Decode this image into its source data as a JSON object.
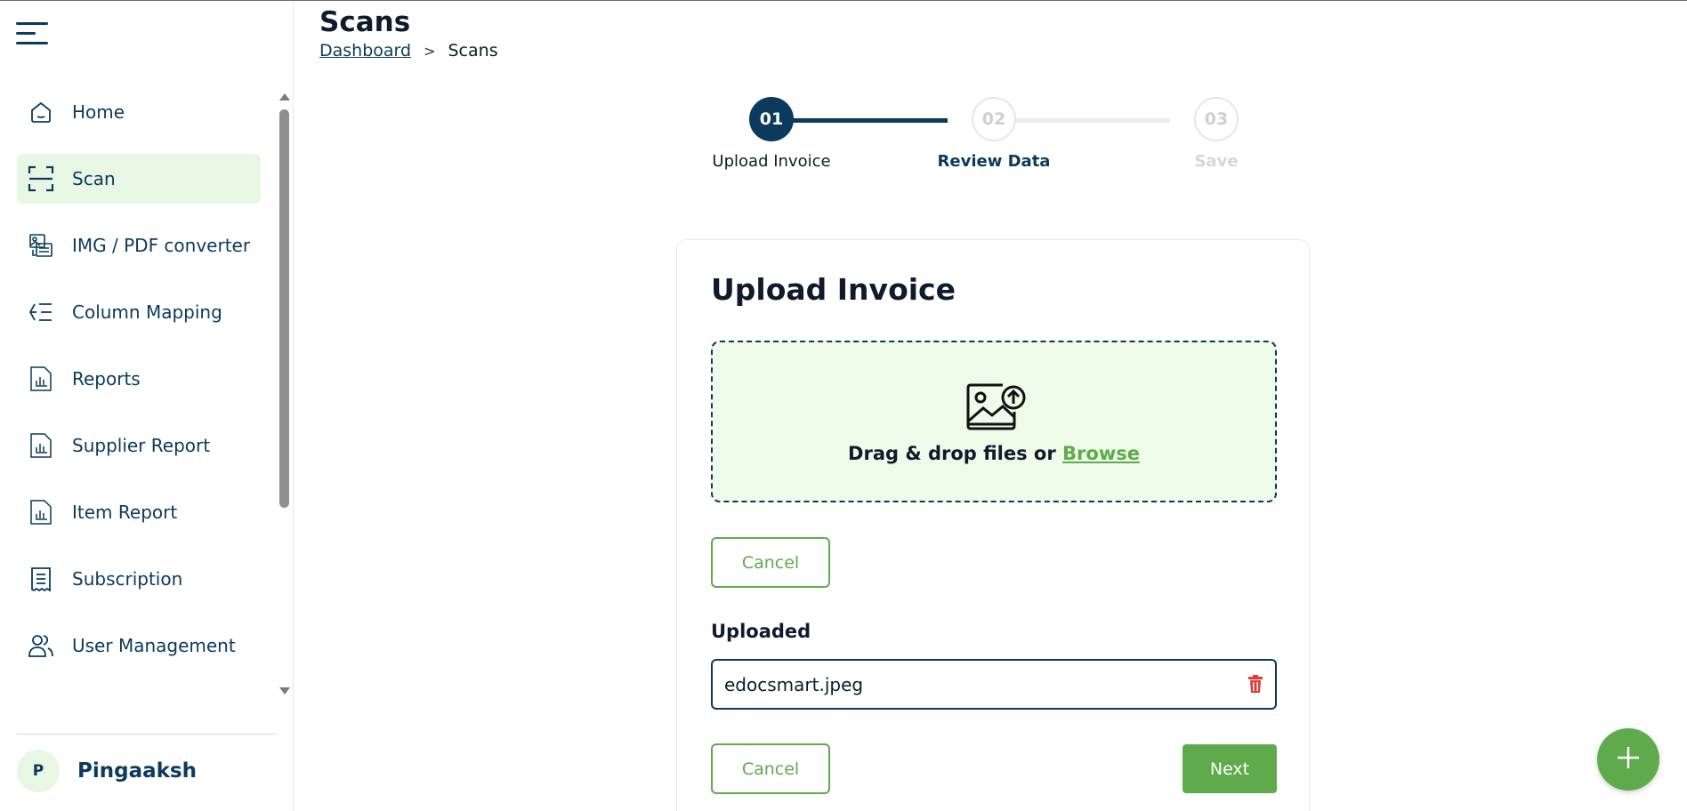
{
  "sidebar": {
    "menu_icon": "hamburger-icon",
    "items": [
      {
        "label": "Home",
        "icon": "home-icon"
      },
      {
        "label": "Scan",
        "icon": "scan-icon",
        "active": true
      },
      {
        "label": "IMG / PDF converter",
        "icon": "image-pdf-icon"
      },
      {
        "label": "Column Mapping",
        "icon": "column-mapping-icon"
      },
      {
        "label": "Reports",
        "icon": "report-chart-icon"
      },
      {
        "label": "Supplier Report",
        "icon": "report-chart-icon"
      },
      {
        "label": "Item Report",
        "icon": "report-chart-icon"
      },
      {
        "label": "Subscription",
        "icon": "receipt-icon"
      },
      {
        "label": "User Management",
        "icon": "users-icon"
      }
    ],
    "user": {
      "initial": "P",
      "name": "Pingaaksh"
    }
  },
  "header": {
    "title": "Scans",
    "breadcrumb": {
      "link": "Dashboard",
      "separator": ">",
      "current": "Scans"
    }
  },
  "stepper": {
    "steps": [
      {
        "number": "01",
        "label": "Upload Invoice",
        "state": "active"
      },
      {
        "number": "02",
        "label": "Review Data",
        "state": "pending"
      },
      {
        "number": "03",
        "label": "Save",
        "state": "disabled"
      }
    ]
  },
  "upload": {
    "title": "Upload Invoice",
    "dropzone_text": "Drag & drop files or",
    "browse_label": "Browse",
    "cancel_label": "Cancel",
    "uploaded_label": "Uploaded",
    "file_name": "edocsmart.jpeg",
    "cancel_bottom_label": "Cancel",
    "next_label": "Next"
  },
  "fab": {
    "icon": "plus-icon"
  },
  "colors": {
    "primary": "#0b3a5c",
    "accent": "#5fab4b",
    "active_bg": "#e8f7e4",
    "danger": "#e53935"
  }
}
